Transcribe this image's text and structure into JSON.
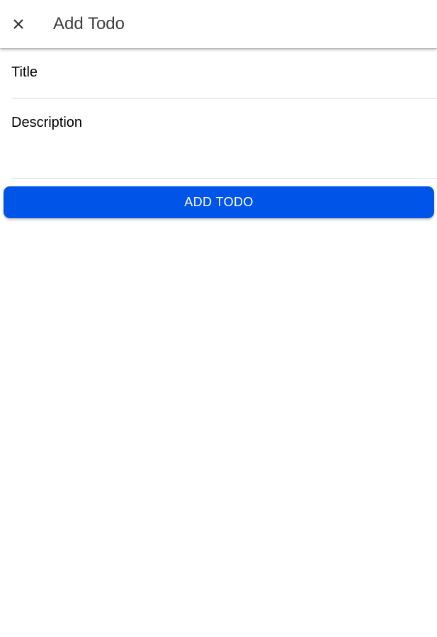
{
  "toolbar": {
    "close_icon": "close-icon",
    "title": "Add Todo"
  },
  "form": {
    "title_field": {
      "placeholder": "Title",
      "value": ""
    },
    "description_field": {
      "placeholder": "Description",
      "value": ""
    },
    "submit_label": "ADD TODO"
  },
  "colors": {
    "accent": "#0055e8",
    "toolbar_text": "#3c3c3c",
    "divider": "#dcdcdc"
  }
}
